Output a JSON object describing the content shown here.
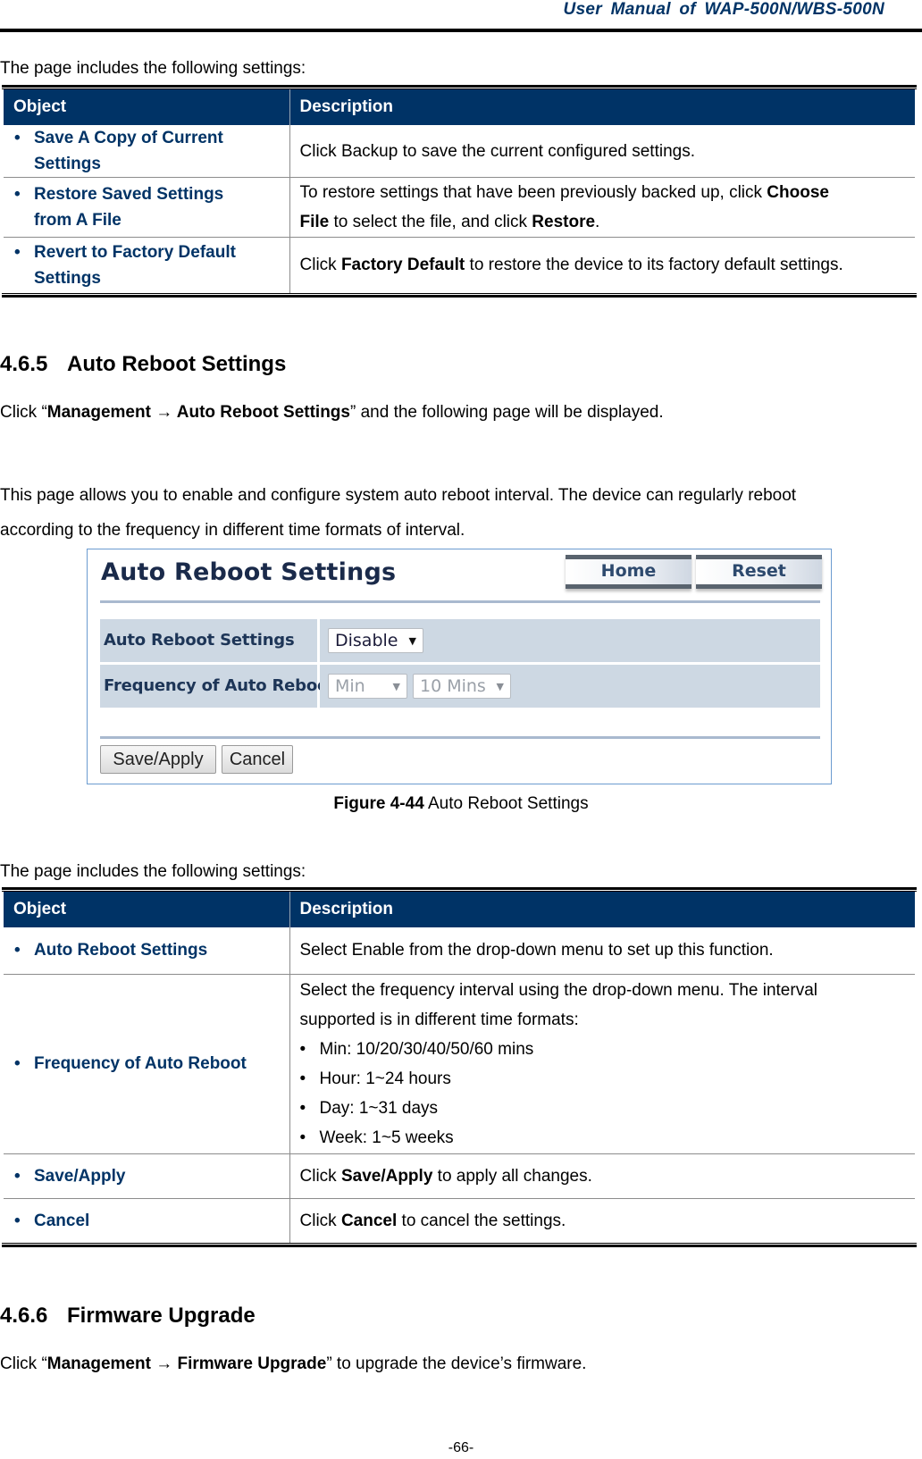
{
  "header": {
    "title": "User  Manual  of  WAP-500N/WBS-500N"
  },
  "intro_1": "The page includes the following settings:",
  "table_1": {
    "columns": [
      "Object",
      "Description"
    ],
    "rows": [
      {
        "object_line1": "Save A Copy of Current",
        "object_line2": "Settings",
        "description": "Click Backup to save the current configured settings."
      },
      {
        "object_line1": "Restore Saved Settings",
        "object_line2": "from A File",
        "desc_a": "To restore settings that have been previously backed up, click ",
        "desc_b": "Choose",
        "desc_c": "File",
        "desc_d": " to select the file, and click ",
        "desc_e": "Restore",
        "desc_f": "."
      },
      {
        "object_line1": "Revert to Factory Default",
        "object_line2": "Settings",
        "desc_a": "Click ",
        "desc_b": "Factory Default",
        "desc_c": " to restore the device to its factory default settings."
      }
    ]
  },
  "section_465": {
    "number": "4.6.5",
    "title": "Auto Reboot Settings",
    "nav_prefix": "Click “",
    "nav_path": "Management → Auto Reboot Settings",
    "nav_suffix": "” and the following page will be displayed.",
    "desc_line1": "This page allows you to enable and configure system auto reboot interval. The device can regularly reboot",
    "desc_line2": "according to the frequency in different time formats of interval."
  },
  "figure": {
    "panel_title": "Auto Reboot Settings",
    "home_button": "Home",
    "reset_button": "Reset",
    "rows": [
      {
        "label": "Auto Reboot Settings",
        "select_value": "Disable"
      },
      {
        "label": "Frequency of Auto Reboot",
        "unit_value": "Min",
        "interval_value": "10 Mins"
      }
    ],
    "save_apply_button": "Save/Apply",
    "cancel_button": "Cancel",
    "caption_label": "Figure 4-44",
    "caption_text": " Auto Reboot Settings"
  },
  "intro_2": "The page includes the following settings:",
  "table_2": {
    "columns": [
      "Object",
      "Description"
    ],
    "rows": [
      {
        "object": "Auto Reboot Settings",
        "description": "Select Enable from the drop-down menu to set up this function."
      },
      {
        "object": "Frequency of Auto Reboot",
        "desc_line1": "Select the frequency interval using the drop-down menu. The interval",
        "desc_line2": "supported is in different time formats:",
        "options": [
          "Min: 10/20/30/40/50/60 mins",
          "Hour: 1~24 hours",
          "Day: 1~31 days",
          "Week: 1~5 weeks"
        ]
      },
      {
        "object": "Save/Apply",
        "desc_a": "Click ",
        "desc_b": "Save/Apply",
        "desc_c": " to apply all changes."
      },
      {
        "object": "Cancel",
        "desc_a": "Click ",
        "desc_b": "Cancel",
        "desc_c": " to cancel the settings."
      }
    ]
  },
  "section_466": {
    "number": "4.6.6",
    "title": "Firmware Upgrade",
    "nav_prefix": "Click “",
    "nav_path": "Management → Firmware Upgrade",
    "nav_suffix": "” to upgrade the device’s firmware."
  },
  "footer": {
    "page_number": "-66-"
  }
}
